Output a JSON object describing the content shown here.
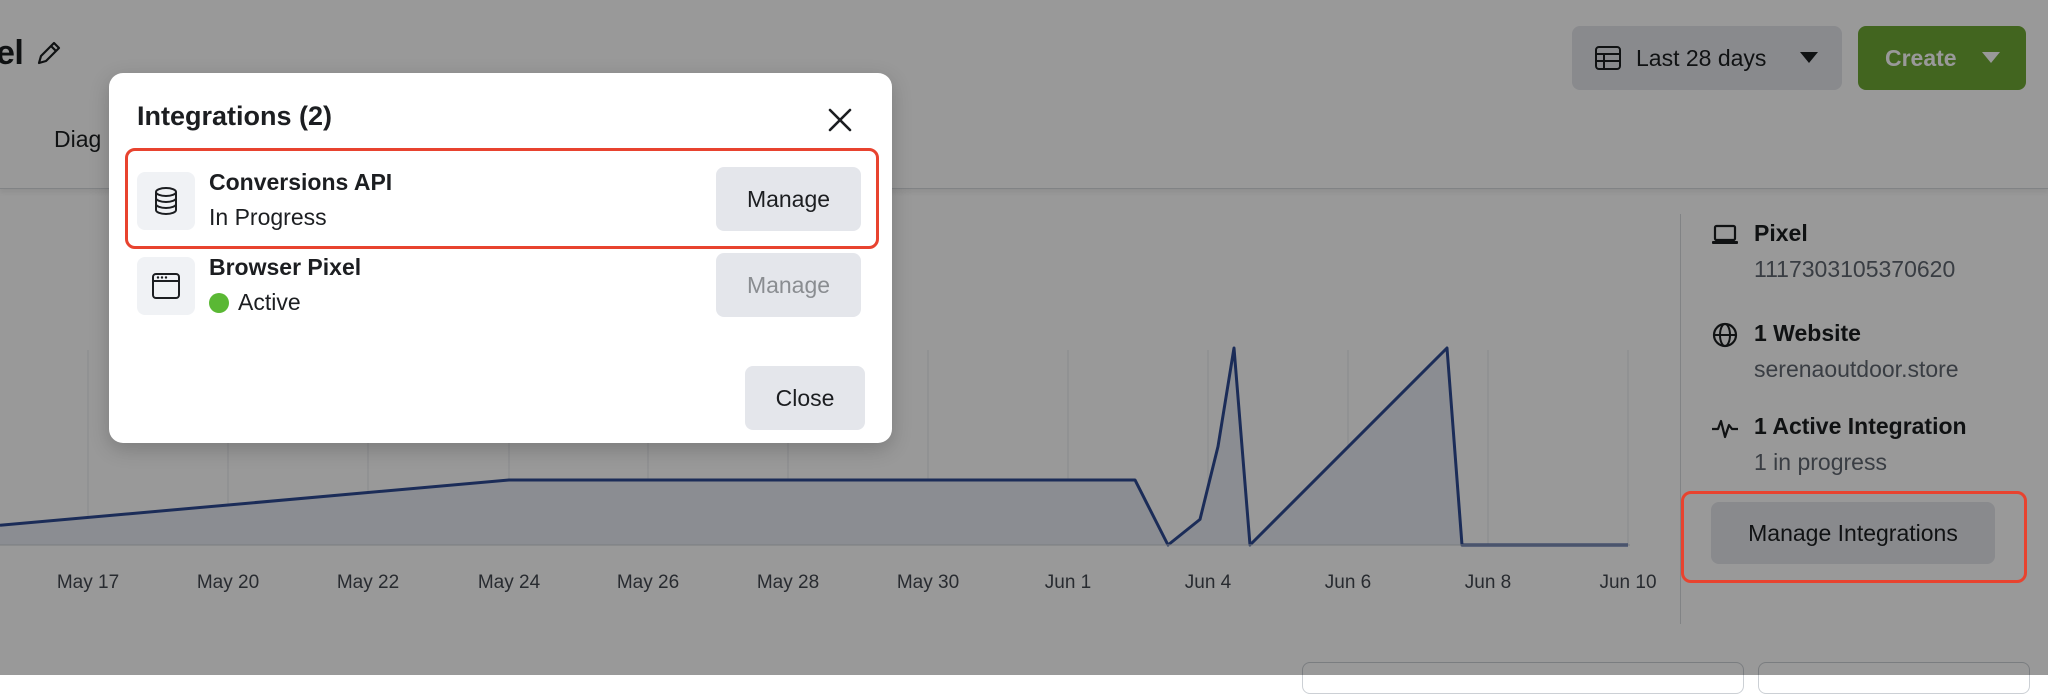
{
  "header": {
    "title_fragment": "el",
    "tab_fragment": "Diag",
    "date_range_label": "Last 28 days",
    "create_label": "Create"
  },
  "chart_data": {
    "type": "area",
    "x_tick_labels": [
      "May 17",
      "May 20",
      "May 22",
      "May 24",
      "May 26",
      "May 28",
      "May 30",
      "Jun 1",
      "Jun 4",
      "Jun 6",
      "Jun 8",
      "Jun 10"
    ],
    "note_units": "relative level, 0 = baseline, 1 = peak",
    "x": [
      "May 15",
      "May 24",
      "May 25",
      "May 26",
      "May 27",
      "May 28",
      "May 29",
      "May 30",
      "May 31",
      "Jun 1",
      "Jun 2",
      "Jun 3",
      "Jun 4",
      "Jun 5",
      "Jun 6",
      "Jun 7",
      "Jun 8",
      "Jun 9",
      "Jun 10"
    ],
    "series": [
      {
        "values": [
          0.1,
          0.33,
          0.33,
          0.33,
          0.33,
          0.33,
          0.33,
          0.33,
          0.33,
          0.33,
          0.33,
          0.0,
          1.0,
          0.0,
          0.33,
          0.66,
          1.0,
          0.0,
          0.0
        ]
      }
    ],
    "grid": true,
    "legend": "none"
  },
  "sidebar_info": {
    "pixel_title": "Pixel",
    "pixel_id": "1117303105370620",
    "website_title": "1 Website",
    "website_value": "serenaoutdoor.store",
    "integration_title": "1 Active Integration",
    "integration_sub": "1 in progress",
    "manage_integrations_label": "Manage Integrations"
  },
  "modal": {
    "title": "Integrations (2)",
    "rows": [
      {
        "name": "Conversions API",
        "status": "In Progress",
        "button": "Manage",
        "icon": "database-icon"
      },
      {
        "name": "Browser Pixel",
        "status": "Active",
        "button": "Manage",
        "icon": "browser-window-icon"
      }
    ],
    "close_label": "Close"
  },
  "colors": {
    "accent_green": "#6fa835",
    "highlight_red": "#e8432f",
    "status_active": "#5ab834",
    "series_line": "#2d4a93"
  }
}
